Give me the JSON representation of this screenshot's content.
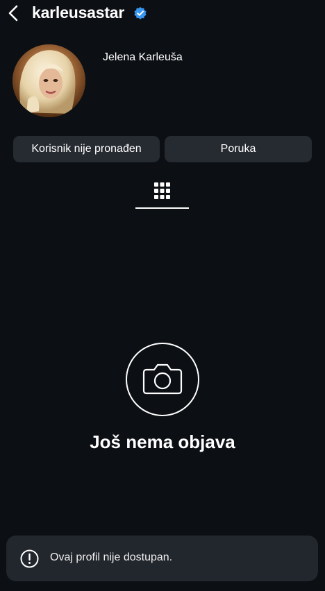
{
  "header": {
    "username": "karleusastar",
    "verified": true,
    "back_icon": "chevron-left-icon",
    "verified_icon": "verified-badge-icon",
    "verified_color": "#3897f0"
  },
  "profile": {
    "display_name": "Jelena Karleuša",
    "avatar": "profile-photo"
  },
  "actions": {
    "primary_label": "Korisnik nije pronađen",
    "secondary_label": "Poruka"
  },
  "tabs": {
    "active": "posts-grid",
    "icon": "grid-icon"
  },
  "empty_state": {
    "icon": "camera-icon",
    "title": "Još nema objava"
  },
  "toast": {
    "icon": "exclamation-circle-icon",
    "message": "Ovaj profil nije dostupan."
  },
  "colors": {
    "background": "#0c0f14",
    "button": "#262a31",
    "toast": "#22262d",
    "text": "#ffffff"
  }
}
